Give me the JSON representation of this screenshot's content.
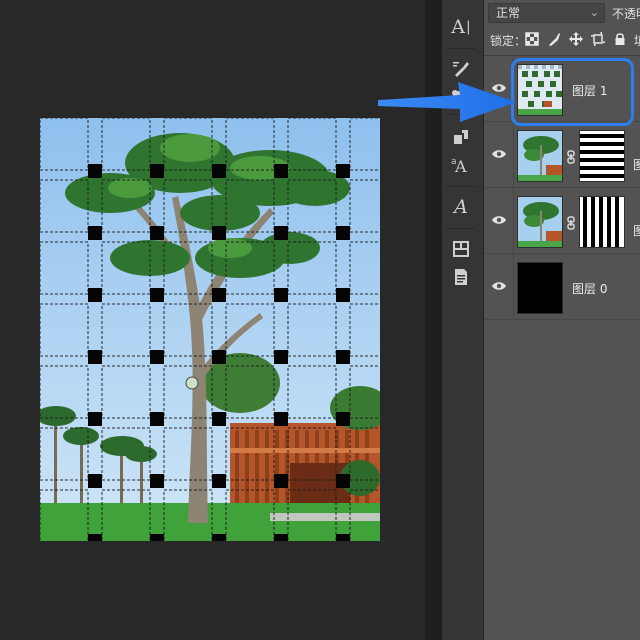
{
  "layers_panel": {
    "blend_mode": "正常",
    "opacity_label": "不透明",
    "lock_label": "锁定：",
    "lock_icons": [
      "lock-transparent-pixels-icon",
      "lock-image-pixels-icon",
      "lock-position-icon",
      "lock-artboard-icon",
      "lock-all-icon"
    ],
    "fill_label": "填",
    "layers": [
      {
        "name": "图层 1",
        "visible": true,
        "selected": true,
        "thumbnail": "woven-photo",
        "has_mask": false
      },
      {
        "name": "图",
        "visible": true,
        "selected": false,
        "thumbnail": "photo",
        "has_mask": true,
        "mask": "horizontal-stripes"
      },
      {
        "name": "图",
        "visible": true,
        "selected": false,
        "thumbnail": "photo",
        "has_mask": true,
        "mask": "vertical-stripes"
      },
      {
        "name": "图层 0",
        "visible": true,
        "selected": false,
        "thumbnail": "black-fill",
        "has_mask": false
      }
    ]
  },
  "tools": [
    "type-tool-icon",
    "brush-preset-icon",
    "smudge-icon",
    "clone-source-icon",
    "character-style-icon",
    "glyph-tool-icon",
    "properties-icon",
    "notes-icon"
  ],
  "tool_labels": {
    "type": "A",
    "glyph": "A"
  },
  "colors": {
    "highlight": "#2d7ff0",
    "panel_bg": "#535353",
    "canvas_bg": "#282828"
  }
}
